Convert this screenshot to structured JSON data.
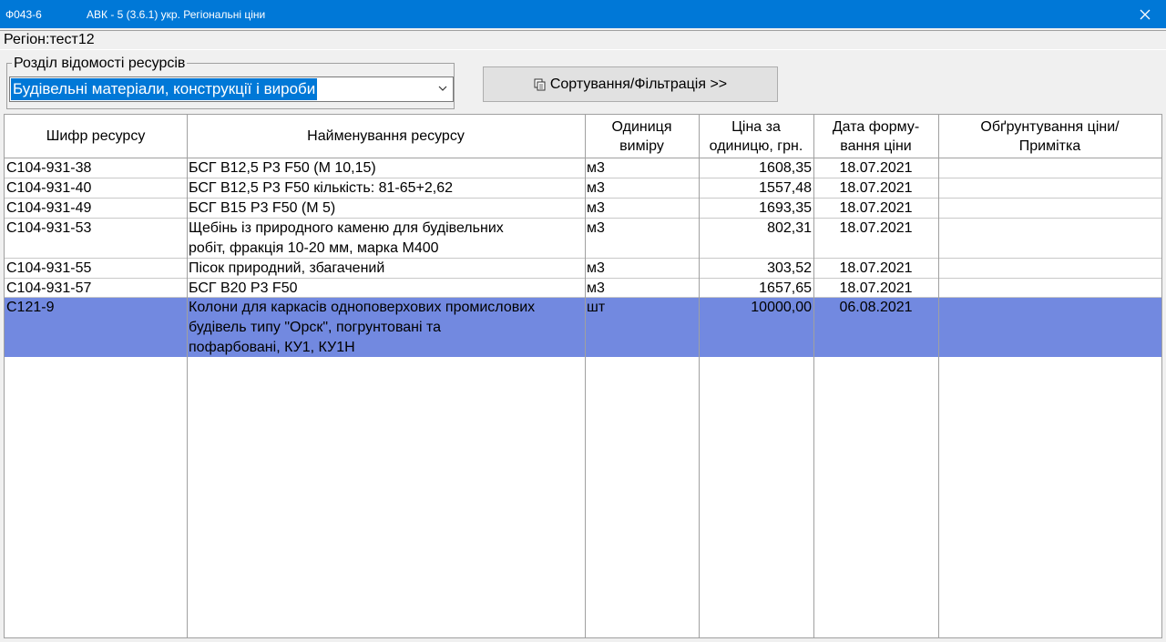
{
  "window": {
    "form_code": "Ф043-6",
    "title": "АВК - 5 (3.6.1) укр. Регіональні ціни",
    "close_icon": "close-icon"
  },
  "region": {
    "label": "Регіон:тест12"
  },
  "section": {
    "group_title": "Розділ відомості ресурсів",
    "selected": "Будівельні матеріали, конструкції і вироби",
    "dropdown_icon": "chevron-down-icon"
  },
  "sort_button": {
    "icon": "copy-icon",
    "label": "Сортування/Фільтрація >>"
  },
  "table": {
    "headers": {
      "code": "Шифр ресурсу",
      "name": "Найменування ресурсу",
      "unit_1": "Одиниця",
      "unit_2": "виміру",
      "price_1": "Ціна за",
      "price_2": "одиницю, грн.",
      "date_1": "Дата форму-",
      "date_2": "вання ціни",
      "note_1": "Обґрунтування ціни/",
      "note_2": "Примітка"
    },
    "rows": [
      {
        "code": "С104-931-38",
        "name_1": "БСГ В12,5 Р3 F50 (М 10,15)",
        "unit": "м3",
        "price": "1608,35",
        "date": "18.07.2021",
        "note": ""
      },
      {
        "code": "С104-931-40",
        "name_1": "БСГ В12,5 Р3 F50 кількість: 81-65+2,62",
        "unit": "м3",
        "price": "1557,48",
        "date": "18.07.2021",
        "note": ""
      },
      {
        "code": "С104-931-49",
        "name_1": "БСГ В15 Р3 F50 (М 5)",
        "unit": "м3",
        "price": "1693,35",
        "date": "18.07.2021",
        "note": ""
      },
      {
        "code": "С104-931-53",
        "name_1": "Щебінь із природного каменю для будівельних",
        "name_2": "робіт, фракція 10-20 мм, марка М400",
        "unit": "м3",
        "price": "802,31",
        "date": "18.07.2021",
        "note": ""
      },
      {
        "code": "С104-931-55",
        "name_1": "Пісок природний, збагачений",
        "unit": "м3",
        "price": "303,52",
        "date": "18.07.2021",
        "note": ""
      },
      {
        "code": "С104-931-57",
        "name_1": "БСГ В20 Р3 F50",
        "unit": "м3",
        "price": "1657,65",
        "date": "18.07.2021",
        "note": ""
      },
      {
        "code": "С121-9",
        "name_1": "Колони для каркасів одноповерхових промислових",
        "name_2": "будівель типу \"Орск\", погрунтовані та",
        "name_3": "пофарбовані, КУ1, КУ1Н",
        "unit": "шт",
        "price": "10000,00",
        "date": "06.08.2021",
        "note": ""
      }
    ]
  }
}
